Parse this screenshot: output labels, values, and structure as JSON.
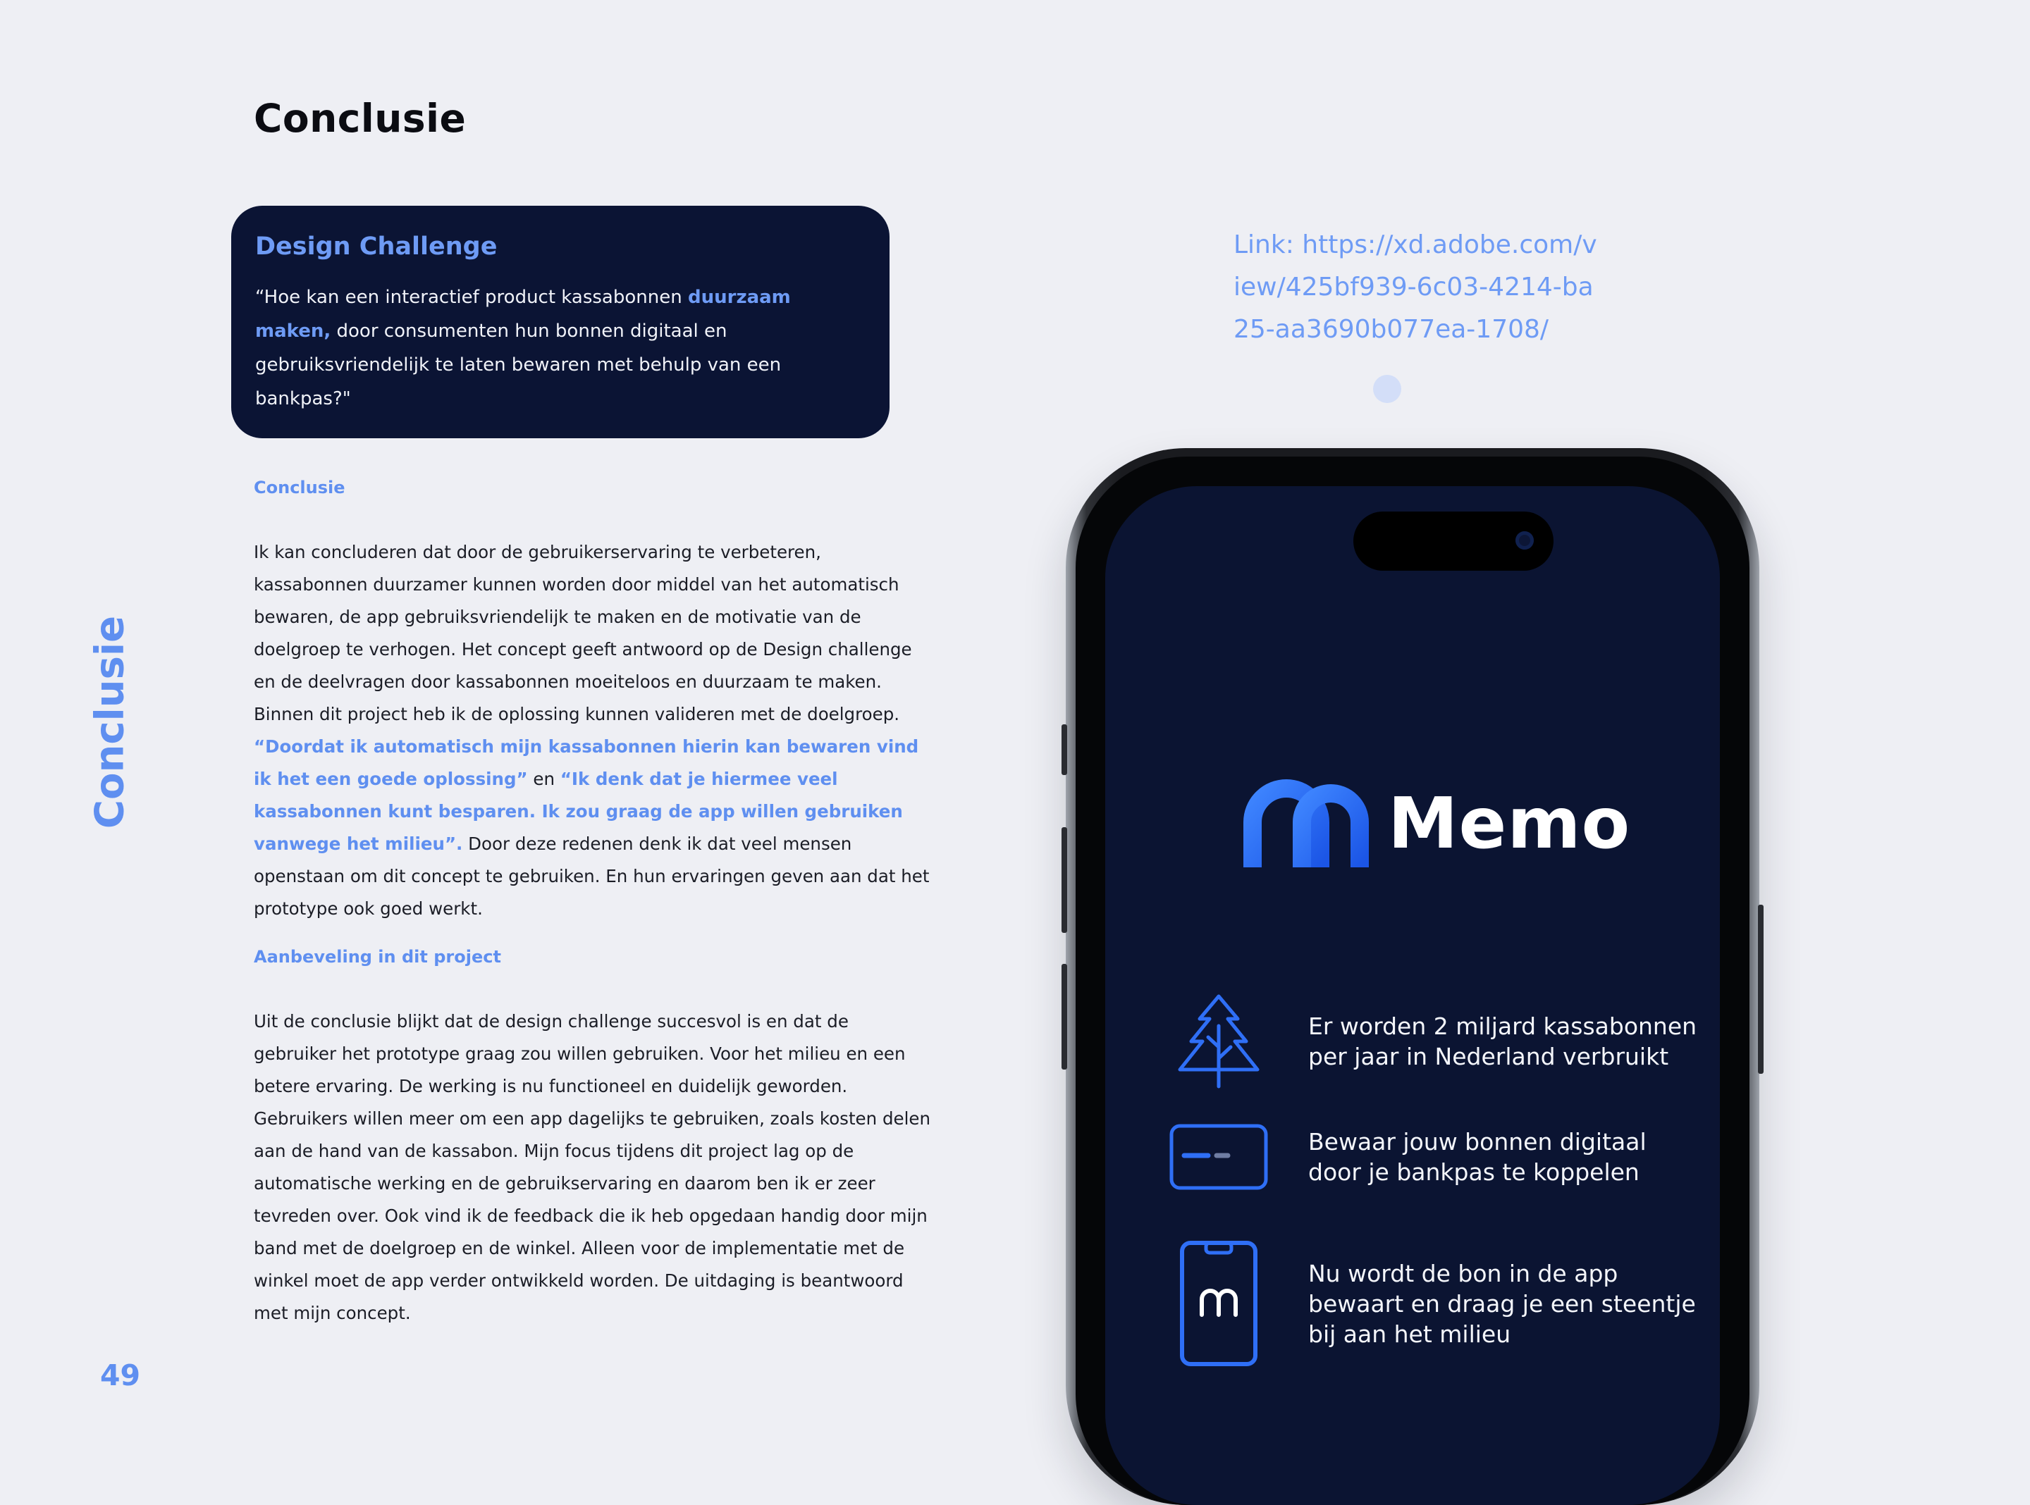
{
  "page": {
    "title": "Conclusie",
    "side_label": "Conclusie",
    "page_number": "49"
  },
  "challenge": {
    "title": "Design Challenge",
    "text_before": "“Hoe kan een interactief product kassabonnen ",
    "highlight": "duurzaam maken,",
    "text_after": " door consumenten hun bonnen digitaal en gebruiksvriendelijk te laten bewaren met behulp van een bankpas?\""
  },
  "conclusion": {
    "heading": "Conclusie",
    "paragraph": "Ik kan concluderen dat door de gebruikerservaring te verbeteren, kassabonnen duurzamer kunnen worden door middel van het automatisch bewaren, de app gebruiksvriendelijk te maken en de motivatie van de doelgroep te verhogen. Het concept geeft antwoord op de Design challenge en de deelvragen door kassabonnen moeiteloos en duurzaam te maken. Binnen dit project heb ik de oplossing kunnen valideren met de doelgroep.",
    "quote1": "“Doordat ik automatisch mijn kassabonnen hierin kan bewaren vind ik het een goede oplossing”",
    "connector": " en ",
    "quote2": "“Ik denk dat je hiermee veel kassabonnen kunt besparen. Ik zou graag de app willen gebruiken vanwege het milieu”.",
    "closing": " Door deze redenen denk ik dat veel mensen openstaan om dit concept te gebruiken. En hun ervaringen geven aan dat het prototype ook goed werkt."
  },
  "recommendation": {
    "heading": "Aanbeveling in dit project",
    "paragraph": "Uit de conclusie blijkt dat de design challenge succesvol is en dat de gebruiker het prototype graag zou willen gebruiken. Voor het milieu en een betere ervaring. De werking is nu functioneel en duidelijk geworden. Gebruikers willen meer om een app dagelijks te gebruiken, zoals kosten delen aan de hand van de kassabon. Mijn focus tijdens dit project lag op de automatische werking en de gebruikservaring en daarom ben ik er zeer tevreden over. Ook vind ik de feedback die ik heb opgedaan handig door mijn band met de doelgroep en de winkel. Alleen voor de implementatie met de winkel moet de app verder ontwikkeld worden. De uitdaging is beantwoord met mijn concept."
  },
  "link": {
    "text": "Link: https://xd.adobe.com/view/425bf939-6c03-4214-ba25-aa3690b077ea-1708/"
  },
  "app": {
    "name": "Memo",
    "features": [
      {
        "icon": "tree-icon",
        "text": "Er worden 2 miljard kassabonnen per jaar in Nederland verbruikt"
      },
      {
        "icon": "bank-card-icon",
        "text": "Bewaar jouw bonnen digitaal door je bankpas te koppelen"
      },
      {
        "icon": "phone-memo-icon",
        "text": "Nu wordt de bon in de app bewaart en draag je een steentje bij aan het milieu"
      }
    ]
  },
  "colors": {
    "accent": "#5f8ff0",
    "card_bg": "#0b1434",
    "screen_bg": "#0b1432",
    "page_bg": "#eeeff4",
    "logo_blue": "#2f6ff6"
  }
}
